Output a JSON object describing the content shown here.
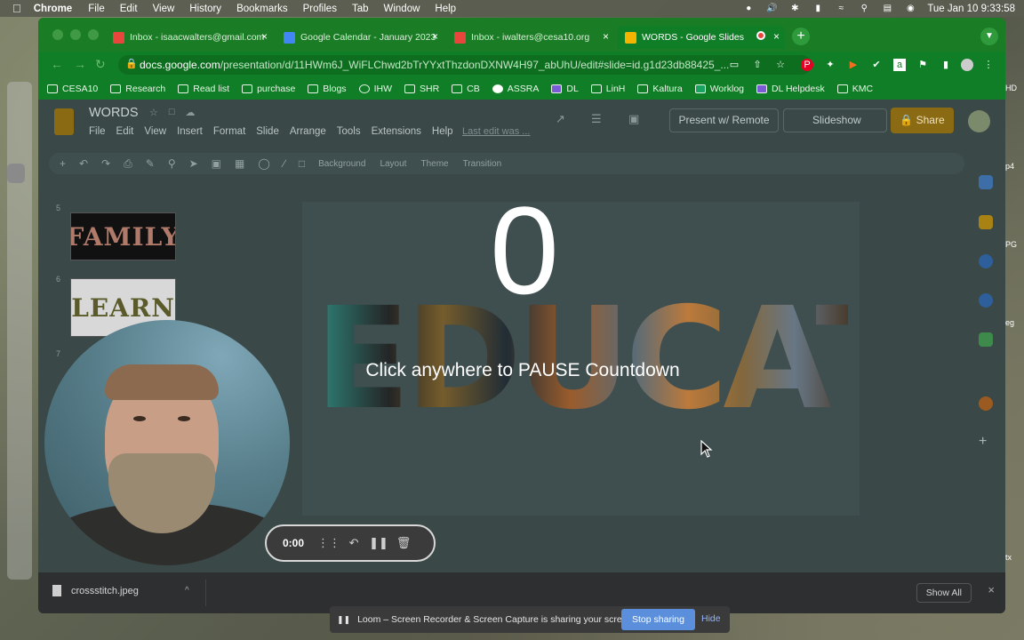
{
  "menubar": {
    "app_name": "Chrome",
    "items": [
      "File",
      "Edit",
      "View",
      "History",
      "Bookmarks",
      "Profiles",
      "Tab",
      "Window",
      "Help"
    ],
    "clock": "Tue Jan 10  9:33:58"
  },
  "tabs": [
    {
      "title": "Inbox - isaacwalters@gmail.com",
      "active": false
    },
    {
      "title": "Google Calendar - January 2023",
      "active": false
    },
    {
      "title": "Inbox - iwalters@cesa10.org",
      "active": false
    },
    {
      "title": "WORDS - Google Slides",
      "active": true
    }
  ],
  "address_bar": {
    "host": "docs.google.com",
    "path": "/presentation/d/11HWm6J_WiFLChwd2bTrYYxtThzdonDXNW4H97_abUhU/edit#slide=id.g1d23db88425_..."
  },
  "bookmarks": [
    "CESA10",
    "Research",
    "Read list",
    "purchase",
    "Blogs",
    "IHW",
    "SHR",
    "CB",
    "ASSRA",
    "DL",
    "LinH",
    "Kaltura",
    "Worklog",
    "DL Helpdesk",
    "KMC"
  ],
  "slides_app": {
    "doc_title": "WORDS",
    "menu": [
      "File",
      "Edit",
      "View",
      "Insert",
      "Format",
      "Slide",
      "Arrange",
      "Tools",
      "Extensions",
      "Help"
    ],
    "last_edit": "Last edit was ...",
    "present_remote": "Present w/ Remote",
    "slideshow": "Slideshow",
    "share": "Share",
    "toolbar_labels": [
      "Background",
      "Layout",
      "Theme",
      "Transition"
    ],
    "filmstrip": [
      {
        "num": "5",
        "word": "FAMILY"
      },
      {
        "num": "6",
        "word": "LEARN"
      },
      {
        "num": "7",
        "word": ""
      }
    ],
    "slide_word": "EDUCATION"
  },
  "overlay": {
    "countdown": "0",
    "message": "Click anywhere to PAUSE Countdown"
  },
  "recorder": {
    "time": "0:00"
  },
  "downloads": {
    "file": "crossstitch.jpeg",
    "show_all": "Show All"
  },
  "loom": {
    "message": "Loom – Screen Recorder & Screen Capture is sharing your screen.",
    "stop": "Stop sharing",
    "hide": "Hide"
  },
  "edge_labels": [
    "HD",
    "p4",
    "PG",
    "eg",
    "tx"
  ],
  "colors": {
    "chrome_theme": "#107e26",
    "share_accent": "#8a6a12",
    "loom_button": "#5b8fdc"
  }
}
